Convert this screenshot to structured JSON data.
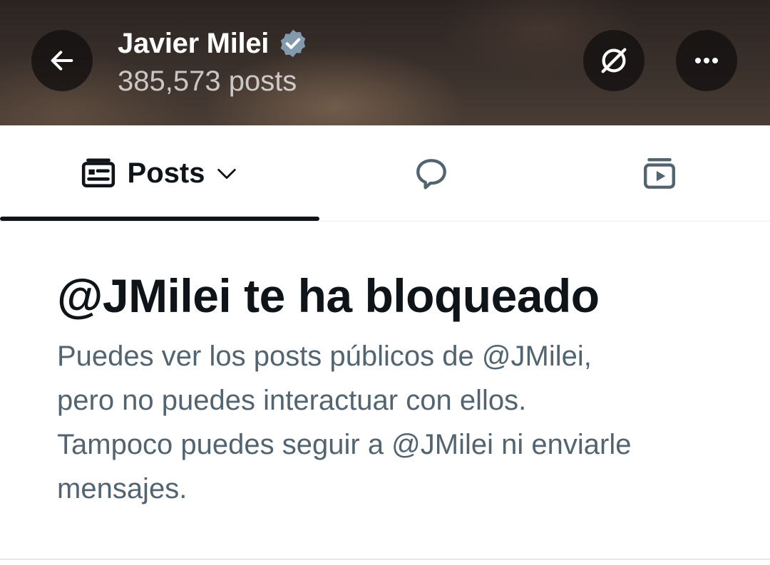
{
  "header": {
    "name": "Javier Milei",
    "post_count": "385,573 posts",
    "verified_color": "#829aab"
  },
  "tabs": [
    {
      "label": "Posts",
      "icon": "posts-list-icon",
      "selected": true
    },
    {
      "label": "",
      "icon": "reply-bubble-icon",
      "selected": false
    },
    {
      "label": "",
      "icon": "media-play-icon",
      "selected": false
    }
  ],
  "blocked": {
    "title": "@JMilei te ha bloqueado",
    "line1": "Puedes ver los posts públicos de @JMilei,",
    "line2": "pero no puedes interactuar con ellos.",
    "line3": "Tampoco puedes seguir a @JMilei ni enviarle",
    "line4": "mensajes."
  },
  "colors": {
    "text_primary": "#0f1419",
    "text_secondary": "#536471"
  }
}
